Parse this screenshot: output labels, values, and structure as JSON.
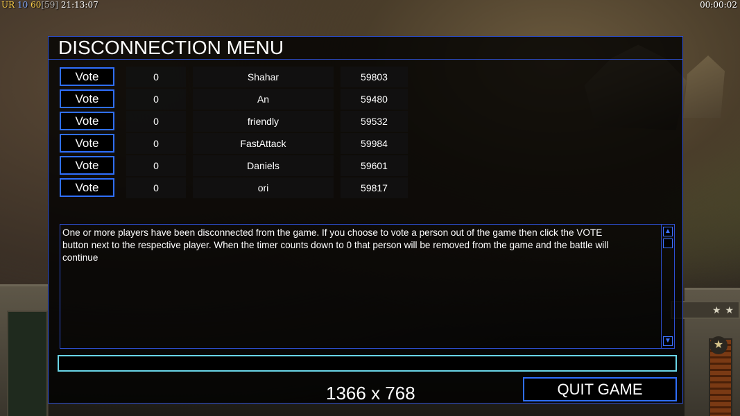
{
  "hud": {
    "left_parts": [
      {
        "text": "UR",
        "color": "#ffd24a"
      },
      {
        "text": "10",
        "color": "#7fa8ff"
      },
      {
        "text": "60",
        "color": "#ffd24a"
      },
      {
        "text": "[59]",
        "color": "#b0b0b0"
      },
      {
        "text": "21:13:07",
        "color": "#ffffff"
      }
    ],
    "timer": "00:00:02"
  },
  "background": {
    "dash_stars": "★ ★",
    "dash_emblem": "★"
  },
  "dialog": {
    "title": "DISCONNECTION MENU",
    "vote_label": "Vote",
    "players": [
      {
        "votes": "0",
        "name": "Shahar",
        "ping": "59803"
      },
      {
        "votes": "0",
        "name": "An",
        "ping": "59480"
      },
      {
        "votes": "0",
        "name": "friendly",
        "ping": "59532"
      },
      {
        "votes": "0",
        "name": "FastAttack",
        "ping": "59984"
      },
      {
        "votes": "0",
        "name": "Daniels",
        "ping": "59601"
      },
      {
        "votes": "0",
        "name": "ori",
        "ping": "59817"
      }
    ],
    "message": "One or more players have been disconnected from the game. If you choose to vote a person out of the game then click the VOTE\n button next to the respective player. When the timer counts down to 0 that person will be removed from the game and the battle will\n continue",
    "chat_value": "",
    "resolution": "1366 x 768",
    "quit_label": "QUIT GAME"
  },
  "colors": {
    "border_blue": "#2d4fd0",
    "button_blue": "#2f6fff",
    "input_cyan": "#6ad6e8"
  }
}
